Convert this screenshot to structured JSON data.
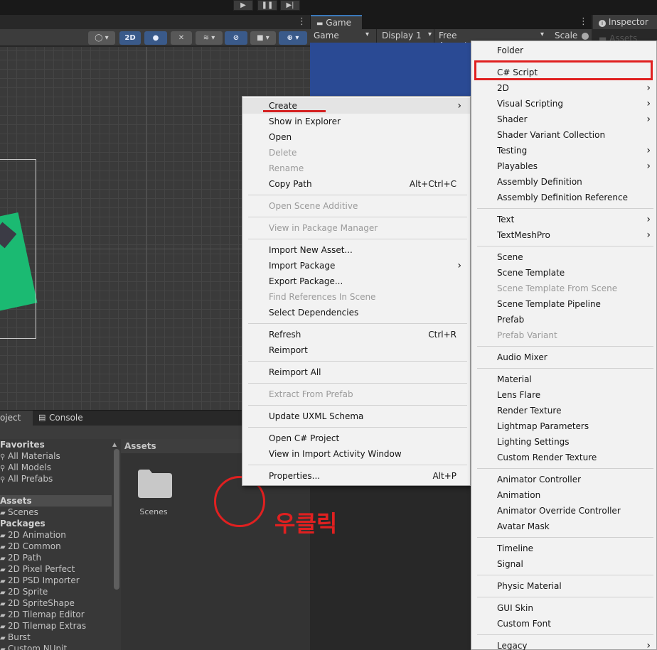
{
  "toolbar": {
    "play": "▶",
    "pause": "❚❚",
    "step": "▶|"
  },
  "scene": {
    "btn_2d": "2D"
  },
  "game": {
    "tab": "Game",
    "mode": "Game",
    "display": "Display 1",
    "aspect": "Free Aspect",
    "scale": "Scale"
  },
  "inspector": {
    "tab": "Inspector",
    "assets_ghost": "Assets"
  },
  "bottom_tabs": {
    "project": "oject",
    "console": "Console"
  },
  "project_tree": [
    {
      "label": "Favorites",
      "bold": true,
      "icon": ""
    },
    {
      "label": "All Materials",
      "bold": false,
      "icon": "search-icon"
    },
    {
      "label": "All Models",
      "bold": false,
      "icon": "search-icon"
    },
    {
      "label": "All Prefabs",
      "bold": false,
      "icon": "search-icon"
    },
    {
      "label": "Assets",
      "bold": true,
      "icon": "",
      "selected": true
    },
    {
      "label": "Scenes",
      "bold": false,
      "icon": "folder-icon"
    },
    {
      "label": "Packages",
      "bold": true,
      "icon": ""
    },
    {
      "label": "2D Animation",
      "bold": false,
      "icon": "folder-icon"
    },
    {
      "label": "2D Common",
      "bold": false,
      "icon": "folder-icon"
    },
    {
      "label": "2D Path",
      "bold": false,
      "icon": "folder-icon"
    },
    {
      "label": "2D Pixel Perfect",
      "bold": false,
      "icon": "folder-icon"
    },
    {
      "label": "2D PSD Importer",
      "bold": false,
      "icon": "folder-icon"
    },
    {
      "label": "2D Sprite",
      "bold": false,
      "icon": "folder-icon"
    },
    {
      "label": "2D SpriteShape",
      "bold": false,
      "icon": "folder-icon"
    },
    {
      "label": "2D Tilemap Editor",
      "bold": false,
      "icon": "folder-icon"
    },
    {
      "label": "2D Tilemap Extras",
      "bold": false,
      "icon": "folder-icon"
    },
    {
      "label": "Burst",
      "bold": false,
      "icon": "folder-icon"
    },
    {
      "label": "Custom NUnit",
      "bold": false,
      "icon": "folder-icon"
    }
  ],
  "assets_panel": {
    "header": "Assets",
    "folder_label": "Scenes"
  },
  "annotation": {
    "text": "우클릭",
    "color": "#e02020"
  },
  "context_menu": {
    "items": [
      {
        "label": "Create",
        "shortcut": "",
        "submenu": true,
        "disabled": false
      },
      {
        "label": "Show in Explorer",
        "shortcut": "",
        "submenu": false,
        "disabled": false
      },
      {
        "label": "Open",
        "shortcut": "",
        "submenu": false,
        "disabled": false
      },
      {
        "label": "Delete",
        "shortcut": "",
        "submenu": false,
        "disabled": true
      },
      {
        "label": "Rename",
        "shortcut": "",
        "submenu": false,
        "disabled": true
      },
      {
        "label": "Copy Path",
        "shortcut": "Alt+Ctrl+C",
        "submenu": false,
        "disabled": false
      },
      {
        "sep": true
      },
      {
        "label": "Open Scene Additive",
        "shortcut": "",
        "submenu": false,
        "disabled": true
      },
      {
        "sep": true
      },
      {
        "label": "View in Package Manager",
        "shortcut": "",
        "submenu": false,
        "disabled": true
      },
      {
        "sep": true
      },
      {
        "label": "Import New Asset...",
        "shortcut": "",
        "submenu": false,
        "disabled": false
      },
      {
        "label": "Import Package",
        "shortcut": "",
        "submenu": true,
        "disabled": false
      },
      {
        "label": "Export Package...",
        "shortcut": "",
        "submenu": false,
        "disabled": false
      },
      {
        "label": "Find References In Scene",
        "shortcut": "",
        "submenu": false,
        "disabled": true
      },
      {
        "label": "Select Dependencies",
        "shortcut": "",
        "submenu": false,
        "disabled": false
      },
      {
        "sep": true
      },
      {
        "label": "Refresh",
        "shortcut": "Ctrl+R",
        "submenu": false,
        "disabled": false
      },
      {
        "label": "Reimport",
        "shortcut": "",
        "submenu": false,
        "disabled": false
      },
      {
        "sep": true
      },
      {
        "label": "Reimport All",
        "shortcut": "",
        "submenu": false,
        "disabled": false
      },
      {
        "sep": true
      },
      {
        "label": "Extract From Prefab",
        "shortcut": "",
        "submenu": false,
        "disabled": true
      },
      {
        "sep": true
      },
      {
        "label": "Update UXML Schema",
        "shortcut": "",
        "submenu": false,
        "disabled": false
      },
      {
        "sep": true
      },
      {
        "label": "Open C# Project",
        "shortcut": "",
        "submenu": false,
        "disabled": false
      },
      {
        "label": "View in Import Activity Window",
        "shortcut": "",
        "submenu": false,
        "disabled": false
      },
      {
        "sep": true
      },
      {
        "label": "Properties...",
        "shortcut": "Alt+P",
        "submenu": false,
        "disabled": false
      }
    ]
  },
  "create_submenu": {
    "items": [
      {
        "label": "Folder",
        "submenu": false,
        "disabled": false
      },
      {
        "sep": true
      },
      {
        "label": "C# Script",
        "submenu": false,
        "disabled": false,
        "highlight": true
      },
      {
        "label": "2D",
        "submenu": true,
        "disabled": false
      },
      {
        "label": "Visual Scripting",
        "submenu": true,
        "disabled": false
      },
      {
        "label": "Shader",
        "submenu": true,
        "disabled": false
      },
      {
        "label": "Shader Variant Collection",
        "submenu": false,
        "disabled": false
      },
      {
        "label": "Testing",
        "submenu": true,
        "disabled": false
      },
      {
        "label": "Playables",
        "submenu": true,
        "disabled": false
      },
      {
        "label": "Assembly Definition",
        "submenu": false,
        "disabled": false
      },
      {
        "label": "Assembly Definition Reference",
        "submenu": false,
        "disabled": false
      },
      {
        "sep": true
      },
      {
        "label": "Text",
        "submenu": true,
        "disabled": false
      },
      {
        "label": "TextMeshPro",
        "submenu": true,
        "disabled": false
      },
      {
        "sep": true
      },
      {
        "label": "Scene",
        "submenu": false,
        "disabled": false
      },
      {
        "label": "Scene Template",
        "submenu": false,
        "disabled": false
      },
      {
        "label": "Scene Template From Scene",
        "submenu": false,
        "disabled": true
      },
      {
        "label": "Scene Template Pipeline",
        "submenu": false,
        "disabled": false
      },
      {
        "label": "Prefab",
        "submenu": false,
        "disabled": false
      },
      {
        "label": "Prefab Variant",
        "submenu": false,
        "disabled": true
      },
      {
        "sep": true
      },
      {
        "label": "Audio Mixer",
        "submenu": false,
        "disabled": false
      },
      {
        "sep": true
      },
      {
        "label": "Material",
        "submenu": false,
        "disabled": false
      },
      {
        "label": "Lens Flare",
        "submenu": false,
        "disabled": false
      },
      {
        "label": "Render Texture",
        "submenu": false,
        "disabled": false
      },
      {
        "label": "Lightmap Parameters",
        "submenu": false,
        "disabled": false
      },
      {
        "label": "Lighting Settings",
        "submenu": false,
        "disabled": false
      },
      {
        "label": "Custom Render Texture",
        "submenu": false,
        "disabled": false
      },
      {
        "sep": true
      },
      {
        "label": "Animator Controller",
        "submenu": false,
        "disabled": false
      },
      {
        "label": "Animation",
        "submenu": false,
        "disabled": false
      },
      {
        "label": "Animator Override Controller",
        "submenu": false,
        "disabled": false
      },
      {
        "label": "Avatar Mask",
        "submenu": false,
        "disabled": false
      },
      {
        "sep": true
      },
      {
        "label": "Timeline",
        "submenu": false,
        "disabled": false
      },
      {
        "label": "Signal",
        "submenu": false,
        "disabled": false
      },
      {
        "sep": true
      },
      {
        "label": "Physic Material",
        "submenu": false,
        "disabled": false
      },
      {
        "sep": true
      },
      {
        "label": "GUI Skin",
        "submenu": false,
        "disabled": false
      },
      {
        "label": "Custom Font",
        "submenu": false,
        "disabled": false
      },
      {
        "sep": true
      },
      {
        "label": "Legacy",
        "submenu": true,
        "disabled": false
      }
    ]
  }
}
